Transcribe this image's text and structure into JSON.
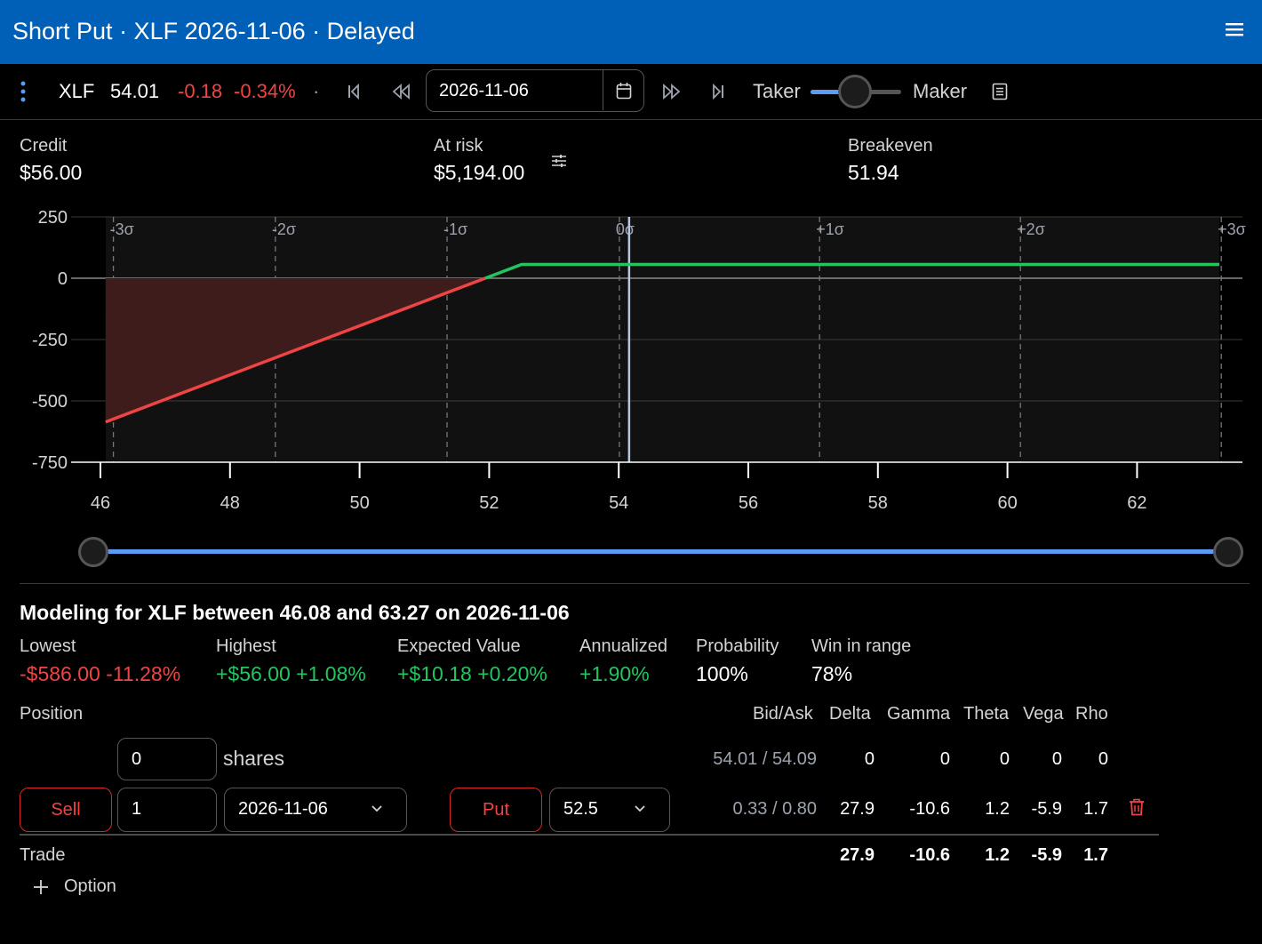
{
  "header": {
    "title": "Short Put · XLF 2026-11-06 · Delayed"
  },
  "toolbar": {
    "symbol": "XLF",
    "price": "54.01",
    "change": "-0.18",
    "change_pct": "-0.34%",
    "dot": "·",
    "date": "2026-11-06",
    "taker_label": "Taker",
    "maker_label": "Maker",
    "slider_level": 0.5
  },
  "stats": {
    "credit_label": "Credit",
    "credit_value": "$56.00",
    "risk_label": "At risk",
    "risk_value": "$5,194.00",
    "breakeven_label": "Breakeven",
    "breakeven_value": "51.94"
  },
  "chart_data": {
    "type": "line",
    "title": "",
    "xlabel": "",
    "ylabel": "",
    "xlim": [
      46,
      63.5
    ],
    "ylim": [
      -750,
      250
    ],
    "x_ticks": [
      46,
      48,
      50,
      52,
      54,
      56,
      58,
      60,
      62
    ],
    "y_ticks": [
      250,
      0,
      -250,
      -500,
      -750
    ],
    "sigma_lines": [
      {
        "label": "-3σ",
        "x": 46.2
      },
      {
        "label": "-2σ",
        "x": 48.7
      },
      {
        "label": "-1σ",
        "x": 51.35
      },
      {
        "label": "0σ",
        "x": 54.01
      },
      {
        "label": "+1σ",
        "x": 57.1
      },
      {
        "label": "+2σ",
        "x": 60.2
      },
      {
        "label": "+3σ",
        "x": 63.3
      }
    ],
    "current_price": 54.16,
    "series": [
      {
        "color": "#ef4444",
        "points": [
          [
            46.08,
            -586
          ],
          [
            51.94,
            0
          ]
        ]
      },
      {
        "color": "#22c55e",
        "points": [
          [
            51.94,
            0
          ],
          [
            52.5,
            56
          ],
          [
            63.27,
            56
          ]
        ]
      }
    ],
    "grid": true
  },
  "range": {
    "low": "46.08",
    "high": "63.27"
  },
  "modeling": {
    "title": "Modeling for XLF between 46.08 and 63.27 on 2026-11-06",
    "lowest_label": "Lowest",
    "lowest_value": "-$586.00 -11.28%",
    "highest_label": "Highest",
    "highest_value": "+$56.00 +1.08%",
    "ev_label": "Expected Value",
    "ev_value": "+$10.18 +0.20%",
    "annualized_label": "Annualized",
    "annualized_value": "+1.90%",
    "probability_label": "Probability",
    "probability_value": "100%",
    "win_label": "Win in range",
    "win_value": "78%"
  },
  "positions": {
    "headers": [
      "Position",
      "Bid/Ask",
      "Delta",
      "Gamma",
      "Theta",
      "Vega",
      "Rho"
    ],
    "shares_row": {
      "qty": "0",
      "unit": "shares",
      "bidask": "54.01 / 54.09",
      "delta": "0",
      "gamma": "0",
      "theta": "0",
      "vega": "0",
      "rho": "0"
    },
    "option_row": {
      "side": "Sell",
      "qty": "1",
      "expiry": "2026-11-06",
      "type": "Put",
      "strike": "52.5",
      "bidask": "0.33 / 0.80",
      "delta": "27.9",
      "gamma": "-10.6",
      "theta": "1.2",
      "vega": "-5.9",
      "rho": "1.7"
    },
    "trade_row": {
      "label": "Trade",
      "delta": "27.9",
      "gamma": "-10.6",
      "theta": "1.2",
      "vega": "-5.9",
      "rho": "1.7"
    },
    "add_option_label": "Option"
  }
}
